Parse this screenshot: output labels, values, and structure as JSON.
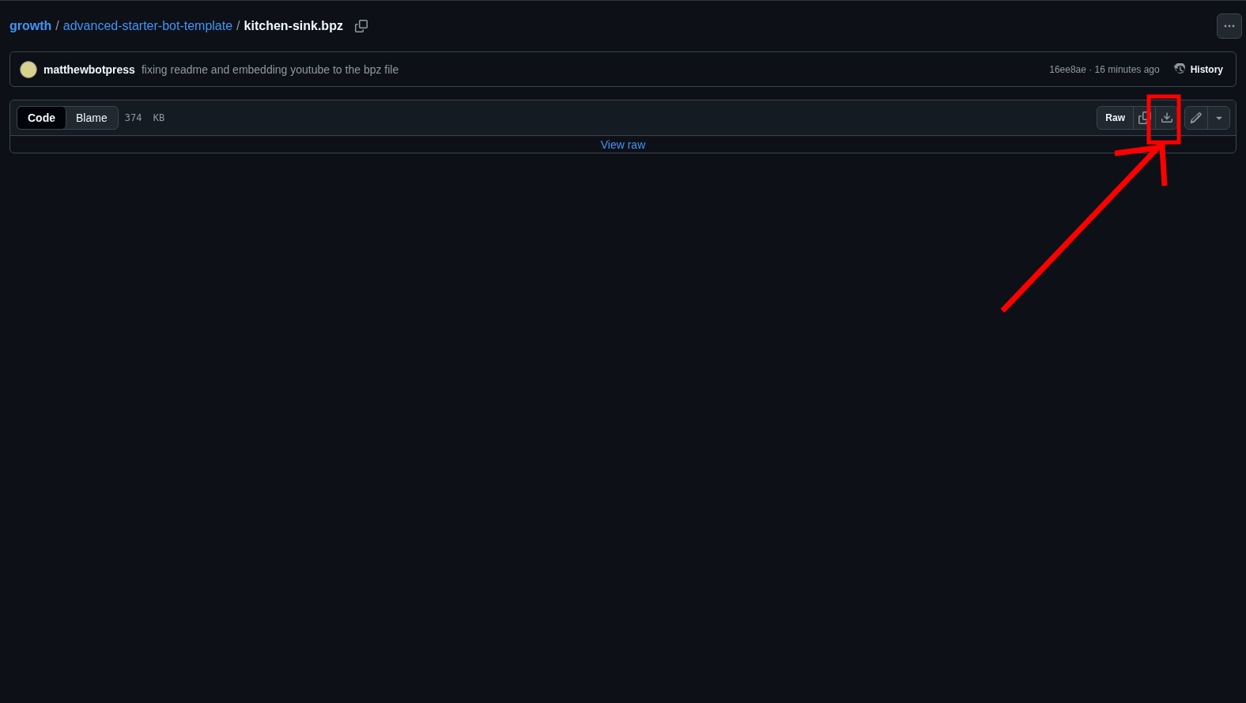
{
  "breadcrumb": {
    "owner": "growth",
    "separator_1": "/",
    "repo": "advanced-starter-bot-template",
    "separator_2": "/",
    "file": "kitchen-sink.bpz"
  },
  "commit": {
    "author": "matthewbotpress",
    "message": "fixing readme and embedding youtube to the bpz file",
    "meta": "16ee8ae · 16 minutes ago",
    "history": "History"
  },
  "file_header": {
    "tabs": [
      {
        "label": "Code",
        "selected": true
      },
      {
        "label": "Blame",
        "selected": false
      }
    ],
    "size": "374  KB",
    "raw": "Raw"
  },
  "body": {
    "link": "View raw"
  }
}
